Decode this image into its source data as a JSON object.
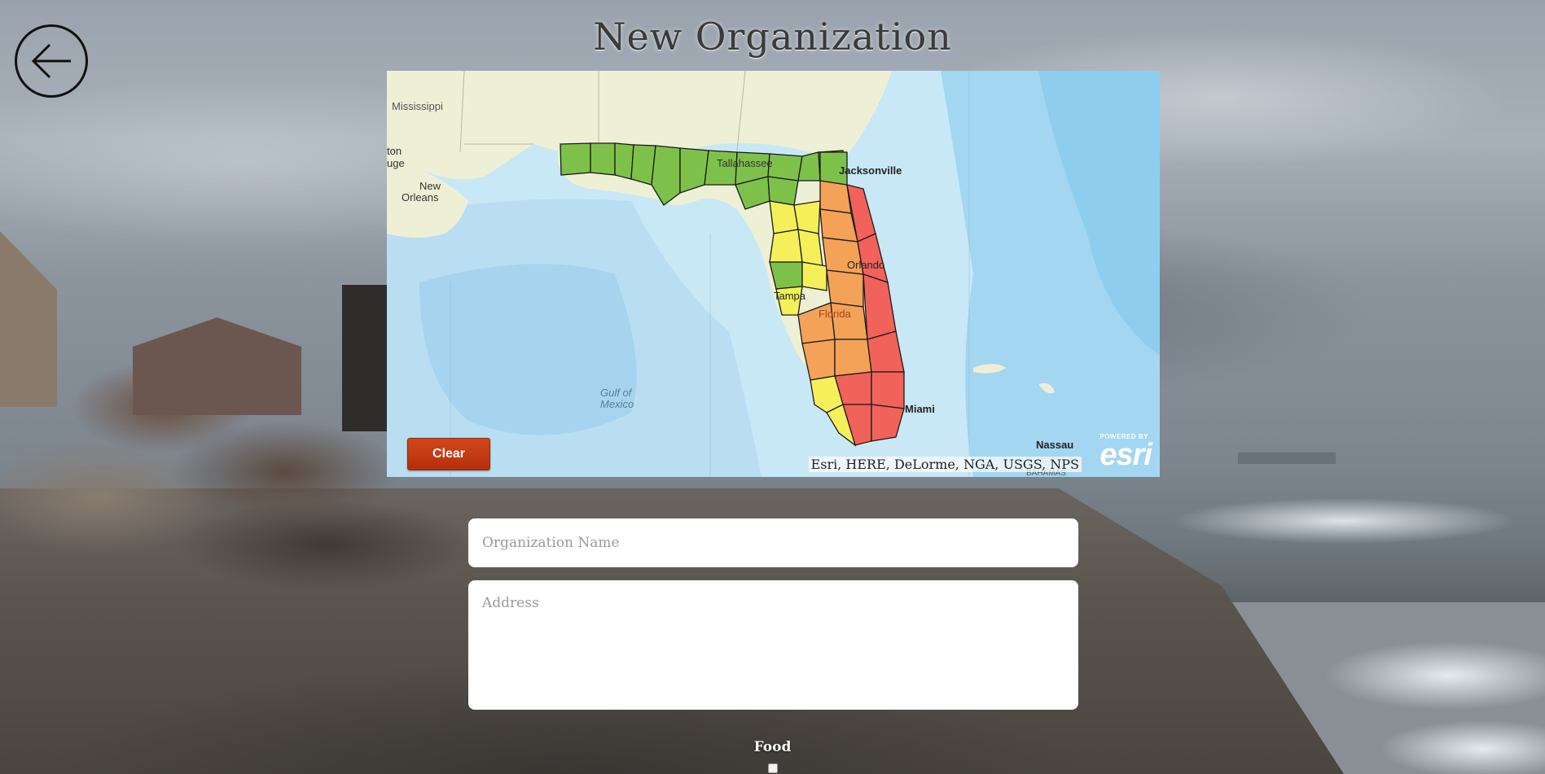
{
  "page": {
    "title": "New Organization",
    "back_icon": "arrow-left-icon"
  },
  "map": {
    "clear_label": "Clear",
    "attribution": "Esri, HERE, DeLorme, NGA, USGS, NPS",
    "logo_powered": "POWERED BY",
    "logo_word": "esri",
    "labels": {
      "mississippi": "Mississippi",
      "baton_rouge": "ton\nuge",
      "new_orleans_1": "New",
      "new_orleans_2": "Orleans",
      "tallahassee": "Tallahassee",
      "jacksonville": "Jacksonville",
      "orlando": "Orlando",
      "tampa": "Tampa",
      "florida": "Florida",
      "miami": "Miami",
      "gulf_1": "Gulf of",
      "gulf_2": "Mexico",
      "nassau": "Nassau",
      "bahamas": "BAHAMAS"
    },
    "zone_colors": {
      "green": "#7ec14a",
      "yellow": "#f5f05a",
      "orange": "#f3a257",
      "red": "#f1625a"
    }
  },
  "form": {
    "org_name_placeholder": "Organization Name",
    "address_placeholder": "Address",
    "food_label": "Food"
  }
}
